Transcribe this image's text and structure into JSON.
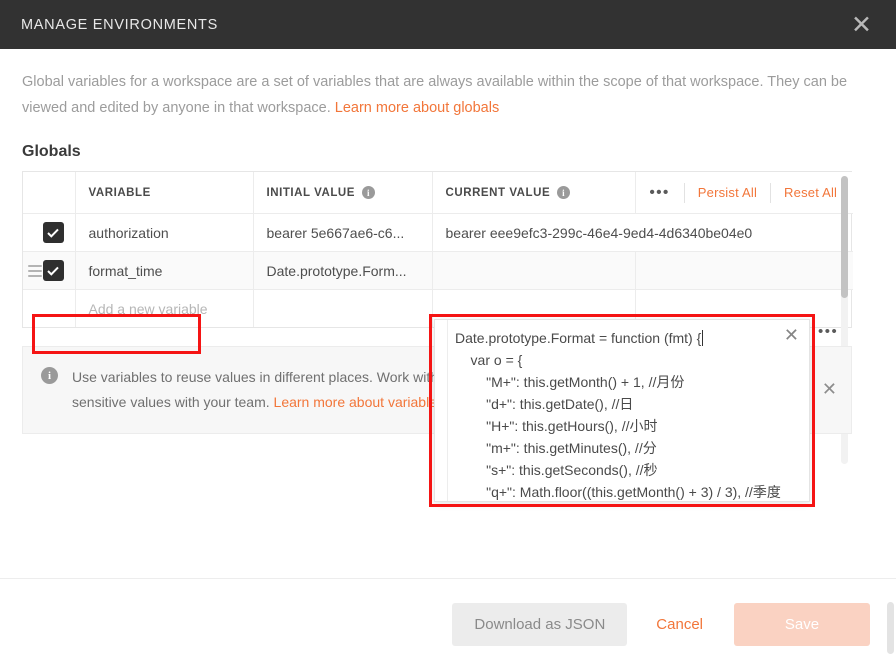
{
  "titlebar": {
    "title": "MANAGE ENVIRONMENTS",
    "close_icon": "close-icon",
    "close_glyph": "✕"
  },
  "intro": {
    "text_before": "Global variables for a workspace are a set of variables that are always available within the scope of that workspace. They can be viewed and edited by anyone in that workspace. ",
    "link_label": "Learn more about globals"
  },
  "section": {
    "title": "Globals"
  },
  "table": {
    "headers": {
      "check": "",
      "variable": "VARIABLE",
      "initial_value": "INITIAL VALUE",
      "current_value": "CURRENT VALUE",
      "info_glyph": "i"
    },
    "header_actions": {
      "more_glyph": "•••",
      "persist_all": "Persist All",
      "reset_all": "Reset All"
    },
    "rows": [
      {
        "checked": true,
        "variable": "authorization",
        "initial_value": "bearer 5e667ae6-c6...",
        "current_value": "bearer eee9efc3-299c-46e4-9ed4-4d6340be04e0",
        "has_drag_handle": false
      },
      {
        "checked": true,
        "variable": "format_time",
        "initial_value": "Date.prototype.Form...",
        "current_value": "",
        "has_drag_handle": true
      }
    ],
    "new_row_placeholder": "Add a new variable"
  },
  "code_editor": {
    "line1": "Date.prototype.Format = function (fmt) {",
    "lines_rest": "    var o = {\n        \"M+\": this.getMonth() + 1, //月份\n        \"d+\": this.getDate(), //日\n        \"H+\": this.getHours(), //小时\n        \"m+\": this.getMinutes(), //分\n        \"s+\": this.getSeconds(), //秒\n        \"q+\": Math.floor((this.getMonth() + 3) / 3), //季度",
    "close_glyph": "✕",
    "more_glyph": "•••"
  },
  "banner": {
    "info_glyph": "i",
    "text_before": "Use variables to reuse values in different places. Work with the current value of a variable to prevent sharing sensitive values with your team. ",
    "link_label": "Learn more about variable values",
    "close_glyph": "✕"
  },
  "footer": {
    "download_label": "Download as JSON",
    "cancel_label": "Cancel",
    "save_label": "Save"
  },
  "colors": {
    "accent": "#f2763a",
    "titlebar_bg": "#323232",
    "save_disabled_bg": "#fad2c2",
    "annotation_red": "#f51414",
    "checkbox_bg": "#2f2f2f"
  }
}
